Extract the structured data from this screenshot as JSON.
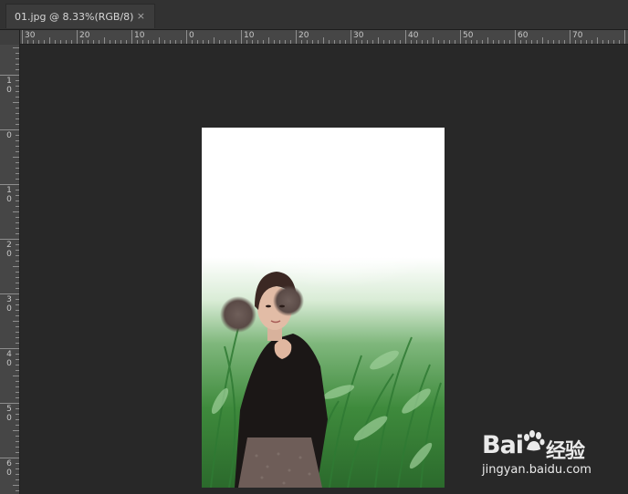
{
  "document_tab": {
    "title": "01.jpg @ 8.33%(RGB/8)",
    "close_glyph": "×"
  },
  "rulers": {
    "horizontal_labels": [
      "30",
      "20",
      "10",
      "0",
      "10",
      "20",
      "30",
      "40",
      "50",
      "60",
      "70"
    ],
    "vertical_labels": [
      [
        "1",
        "0"
      ],
      [
        "0"
      ],
      [
        "1",
        "0"
      ],
      [
        "2",
        "0"
      ],
      [
        "3",
        "0"
      ],
      [
        "4",
        "0"
      ],
      [
        "5",
        "0"
      ],
      [
        "6",
        "0"
      ]
    ]
  },
  "watermark": {
    "brand": "Bai",
    "brand_suffix": "经验",
    "site": "jingyan.baidu.com"
  },
  "colors": {
    "app_background": "#282828",
    "ruler": "#464646",
    "tab_active": "#3c3c3c"
  }
}
